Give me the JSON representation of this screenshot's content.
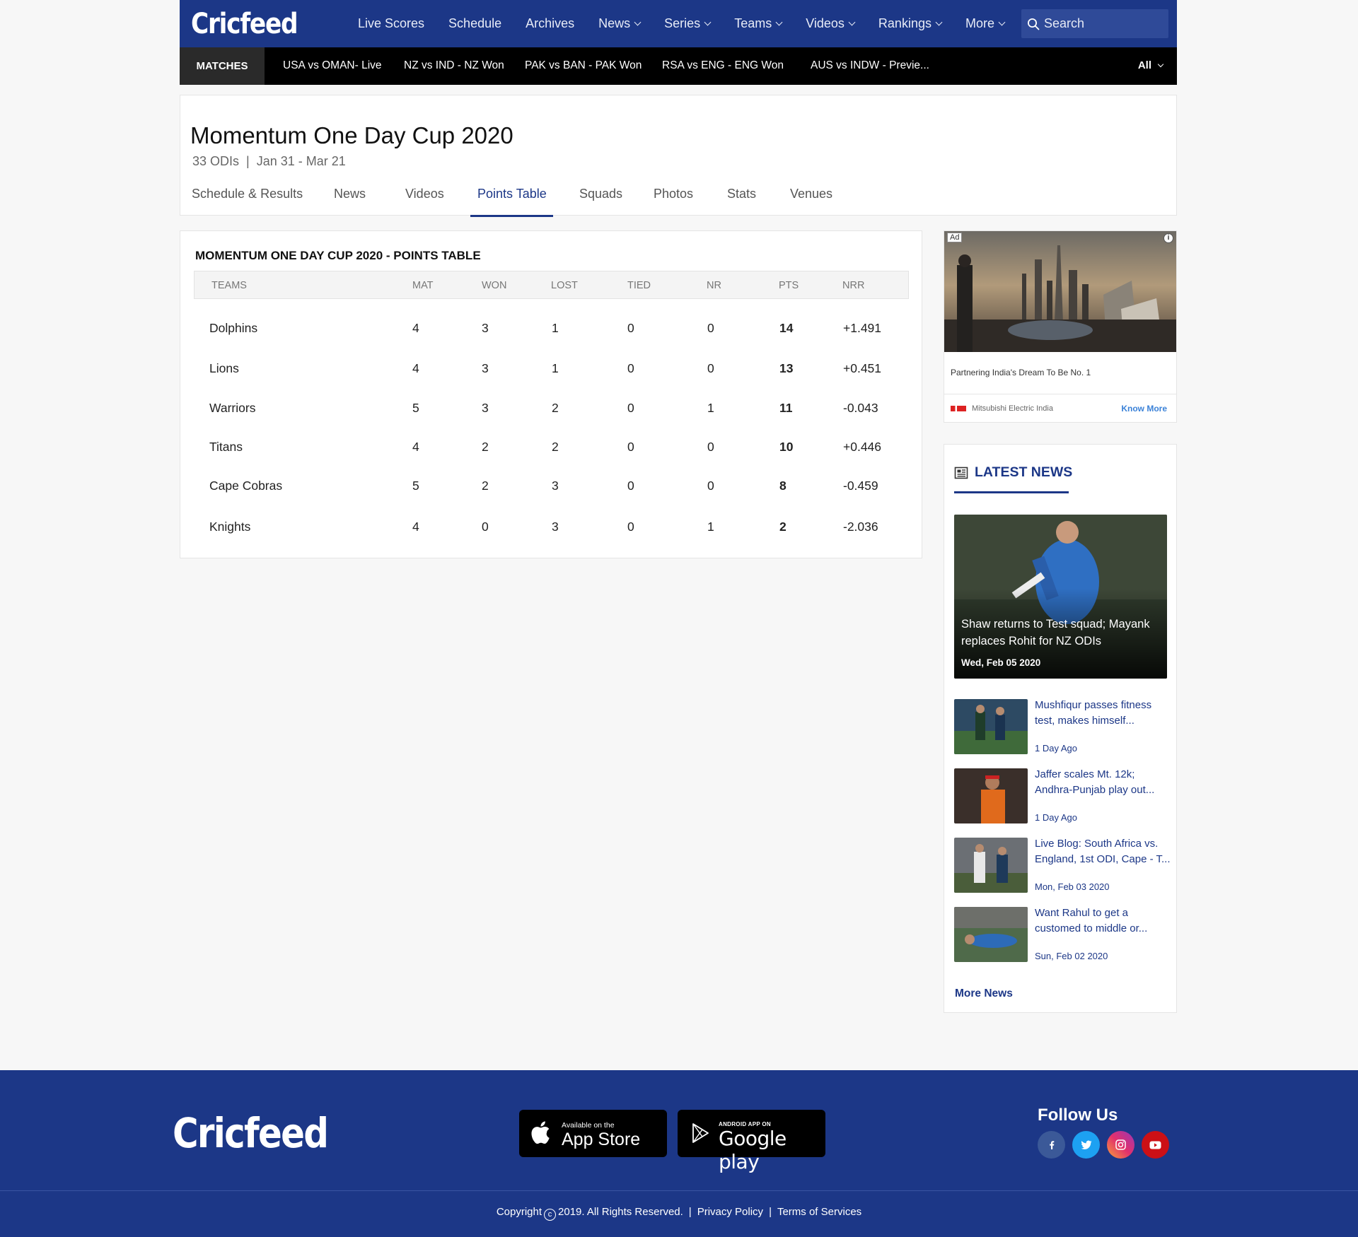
{
  "header": {
    "logo": "Cricfeed",
    "nav": [
      {
        "label": "Live Scores",
        "dropdown": false
      },
      {
        "label": "Schedule",
        "dropdown": false
      },
      {
        "label": "Archives",
        "dropdown": false
      },
      {
        "label": "News",
        "dropdown": true
      },
      {
        "label": "Series",
        "dropdown": true
      },
      {
        "label": "Teams",
        "dropdown": true
      },
      {
        "label": "Videos",
        "dropdown": true
      },
      {
        "label": "Rankings",
        "dropdown": true
      },
      {
        "label": "More",
        "dropdown": true
      }
    ],
    "search_placeholder": "Search"
  },
  "matchbar": {
    "label": "MATCHES",
    "items": [
      "USA vs OMAN- Live",
      "NZ vs IND - NZ Won",
      "PAK vs BAN - PAK Won",
      "RSA vs  ENG - ENG Won",
      "AUS vs INDW - Previe..."
    ],
    "filter": "All"
  },
  "series": {
    "title": "Momentum One Day Cup 2020",
    "matches": "33 ODIs",
    "separator": "|",
    "dates": "Jan 31 - Mar 21",
    "tabs": [
      "Schedule & Results",
      "News",
      "Videos",
      "Points Table",
      "Squads",
      "Photos",
      "Stats",
      "Venues"
    ],
    "active_tab": "Points Table"
  },
  "points_table": {
    "title": "MOMENTUM ONE DAY CUP 2020 - POINTS TABLE",
    "columns": [
      "TEAMS",
      "MAT",
      "WON",
      "LOST",
      "TIED",
      "NR",
      "PTS",
      "NRR"
    ],
    "rows": [
      [
        "Dolphins",
        "4",
        "3",
        "1",
        "0",
        "0",
        "14",
        "+1.491"
      ],
      [
        "Lions",
        "4",
        "3",
        "1",
        "0",
        "0",
        "13",
        "+0.451"
      ],
      [
        "Warriors",
        "5",
        "3",
        "2",
        "0",
        "1",
        "11",
        "-0.043"
      ],
      [
        "Titans",
        "4",
        "2",
        "2",
        "0",
        "0",
        "10",
        "+0.446"
      ],
      [
        "Cape Cobras",
        "5",
        "2",
        "3",
        "0",
        "0",
        "8",
        "-0.459"
      ],
      [
        "Knights",
        "4",
        "0",
        "3",
        "0",
        "1",
        "2",
        "-2.036"
      ]
    ]
  },
  "ad": {
    "badge": "Ad",
    "info": "i",
    "text": "Partnering India's Dream To Be No. 1",
    "brand": "Mitsubishi Electric India",
    "cta": "Know More"
  },
  "latest_news": {
    "title": "LATEST NEWS",
    "feature": {
      "title": "Shaw returns to Test squad; Mayank replaces Rohit for NZ ODIs",
      "date": "Wed, Feb 05 2020"
    },
    "items": [
      {
        "title": "Mushfiqur passes fitness test, makes himself...",
        "date": "1 Day Ago"
      },
      {
        "title": "Jaffer scales Mt. 12k; Andhra-Punjab play out...",
        "date": "1 Day Ago"
      },
      {
        "title": "Live Blog: South Africa vs. England, 1st ODI, Cape - T...",
        "date": "Mon, Feb 03 2020"
      },
      {
        "title": "Want Rahul to get a customed to middle or...",
        "date": "Sun, Feb 02 2020"
      }
    ],
    "more": "More News"
  },
  "footer": {
    "logo": "Cricfeed",
    "app_store": {
      "small": "Available on the",
      "big": "App Store"
    },
    "google_play": {
      "small": "ANDROID APP ON",
      "big": "Google play"
    },
    "follow": "Follow Us",
    "social": [
      {
        "icon": "facebook-icon",
        "color": "#3b5998",
        "glyph": "f"
      },
      {
        "icon": "twitter-icon",
        "color": "#1da1f2",
        "glyph": "t"
      },
      {
        "icon": "instagram-icon",
        "color": "#d6249f",
        "glyph": "ig"
      },
      {
        "icon": "youtube-icon",
        "color": "#cc1016",
        "glyph": "yt"
      }
    ],
    "copyright_pre": "Copyright",
    "copyright_symbol": "c",
    "copyright_post": "2019. All Rights Reserved.",
    "separator": "|",
    "links": [
      "Privacy Policy",
      "Terms of Services"
    ]
  },
  "colors": {
    "brand": "#1c3787",
    "matchbar": "#000000",
    "footer": "#1c3787"
  }
}
